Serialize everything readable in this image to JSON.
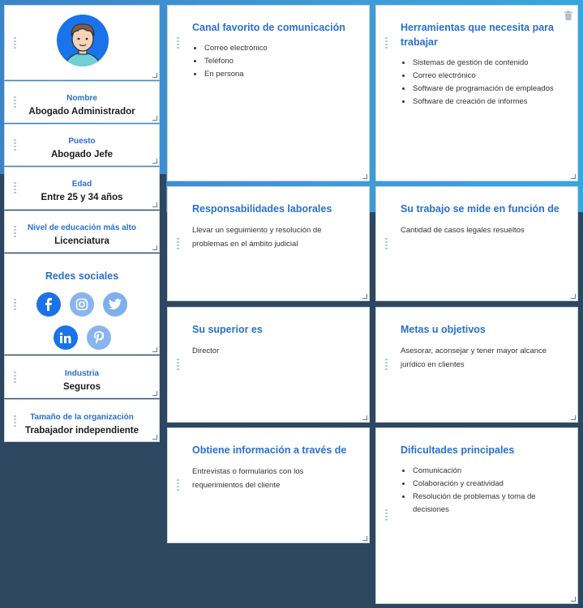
{
  "profile": {
    "avatar_alt": "",
    "fields": [
      {
        "label": "Nombre",
        "value": "Abogado Administrador"
      },
      {
        "label": "Puesto",
        "value": "Abogado Jefe"
      },
      {
        "label": "Edad",
        "value": "Entre 25 y 34 años"
      },
      {
        "label": "Nivel de educación más alto",
        "value": "Licenciatura"
      }
    ],
    "social": {
      "title": "Redes sociales",
      "icons": [
        "facebook-icon",
        "instagram-icon",
        "twitter-icon",
        "linkedin-icon",
        "pinterest-icon"
      ]
    },
    "fields2": [
      {
        "label": "Industria",
        "value": "Seguros"
      },
      {
        "label": "Tamaño de la organización",
        "value": "Trabajador independiente"
      }
    ]
  },
  "cards": {
    "canal": {
      "title": "Canal favorito de comunicación",
      "items": [
        "Correo electrónico",
        "Teléfono",
        "En persona"
      ]
    },
    "herramientas": {
      "title": "Herramientas que necesita para trabajar",
      "items": [
        "Sistemas de gestión de contenido",
        "Correo electrónico",
        "Software de programación de empleados",
        "Software de creación de informes"
      ]
    },
    "responsabilidades": {
      "title": "Responsabilidades laborales",
      "text": "Llevar un seguimiento y resolución de problemas en el ámbito judicial"
    },
    "medicion": {
      "title": "Su trabajo se mide en función de",
      "text": "Cantidad de casos legales resueltos"
    },
    "superior": {
      "title": "Su superior es",
      "text": "Director"
    },
    "metas": {
      "title": "Metas u objetivos",
      "text": "Asesorar, aconsejar y tener mayor alcance jurídico en clientes"
    },
    "informacion": {
      "title": "Obtiene información a través de",
      "text": "Entrevistas o formularios con los requerimientos del cliente"
    },
    "dificultades": {
      "title": "Dificultades principales",
      "items": [
        "Comunicación",
        "Colaboración y creatividad",
        "Resolución de problemas y toma de decisiones"
      ]
    }
  },
  "colors": {
    "accent": "#2a6fcf",
    "facebook": "#1a73e8",
    "instagram": "#8ab4f0",
    "twitter": "#7fb0ec",
    "linkedin": "#1a73e8",
    "pinterest": "#8ab4f0"
  }
}
